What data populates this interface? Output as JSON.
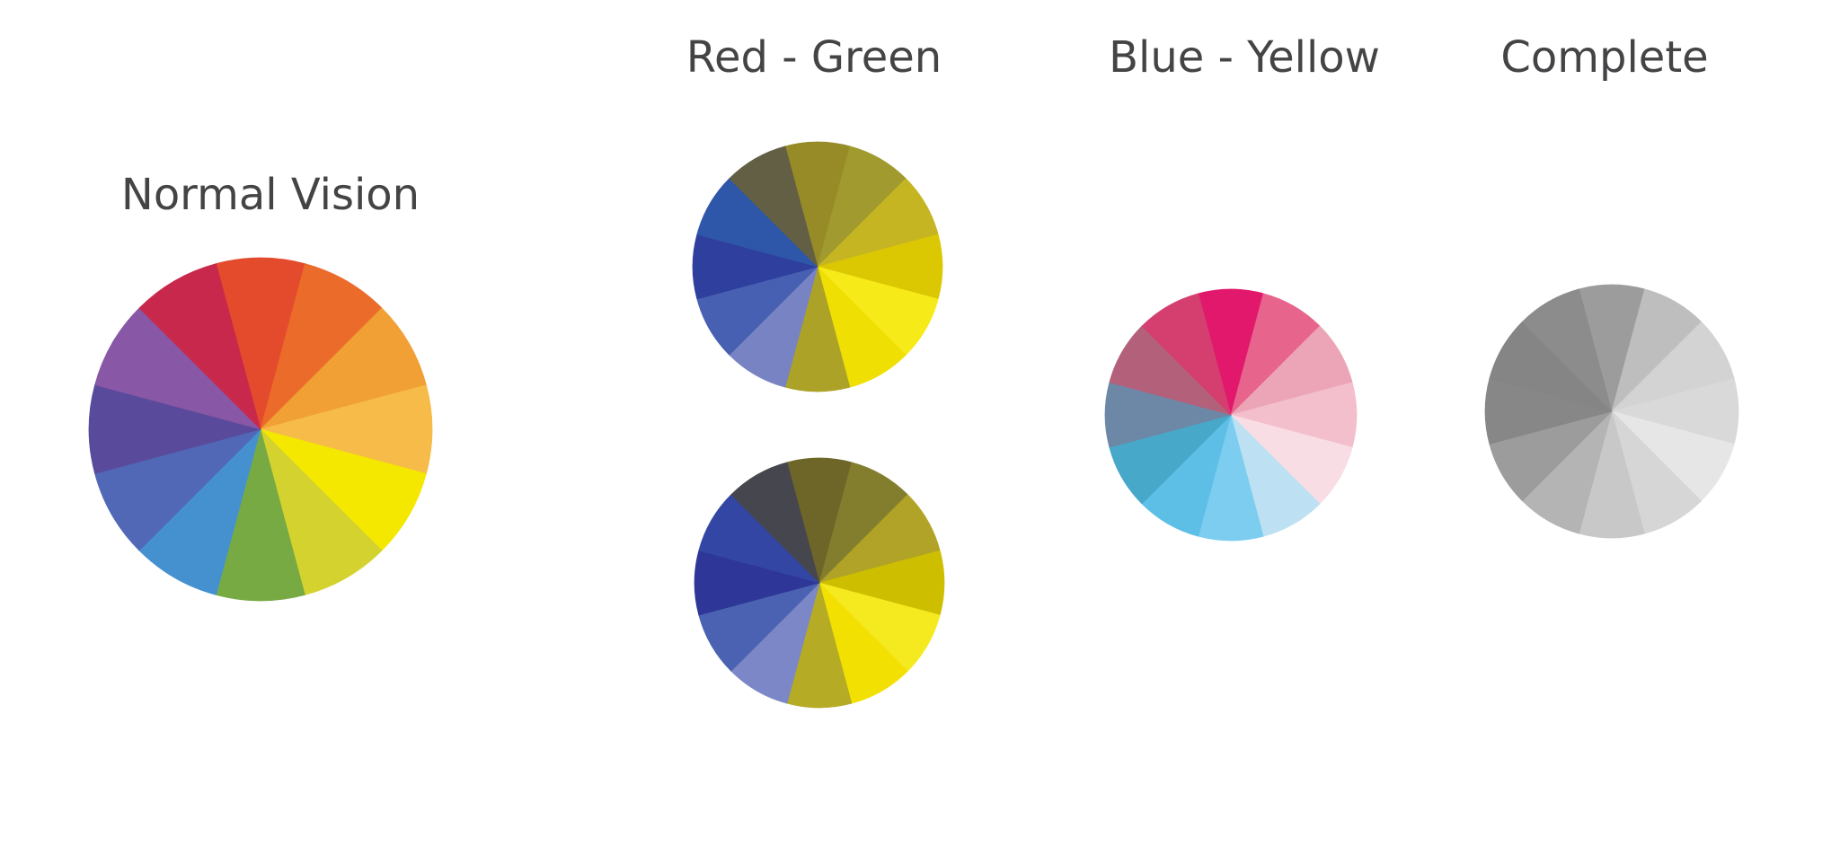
{
  "titles": {
    "normal": "Normal Vision",
    "red_green": "Red - Green",
    "blue_yellow": "Blue - Yellow",
    "complete": "Complete"
  },
  "wheels": {
    "normal": [
      "#e44a2c",
      "#ea6b2a",
      "#f0a035",
      "#f6bb48",
      "#f4e700",
      "#d4d22f",
      "#78aa44",
      "#4591d0",
      "#5168b7",
      "#5a4a9c",
      "#8857a6",
      "#c8284b"
    ],
    "red_green_protan": [
      "#978b28",
      "#a19a2f",
      "#c5b523",
      "#dbc702",
      "#f6ea19",
      "#efdf03",
      "#aca228",
      "#7883c3",
      "#4760b2",
      "#2e3f9d",
      "#2e57a9",
      "#635f45"
    ],
    "red_green_deutan": [
      "#6e6529",
      "#837d2e",
      "#b0a327",
      "#cebe00",
      "#f5ea1f",
      "#f3e003",
      "#b5ab25",
      "#7c87c7",
      "#4a62b1",
      "#2e3797",
      "#3346a4",
      "#46464f"
    ],
    "blue_yellow": [
      "#e2186c",
      "#e7648c",
      "#eca5b6",
      "#f4bfcc",
      "#f9dde4",
      "#bde1f2",
      "#7ccdf0",
      "#5dbfe6",
      "#47a8ca",
      "#6d88a6",
      "#b3607b",
      "#d43f70"
    ],
    "complete": [
      "#9c9c9c",
      "#bebebe",
      "#d3d3d3",
      "#d9d9d9",
      "#e6e6e6",
      "#d6d6d6",
      "#c8c8c8",
      "#b4b4b4",
      "#9c9c9c",
      "#878787",
      "#858585",
      "#8c8c8c"
    ]
  }
}
